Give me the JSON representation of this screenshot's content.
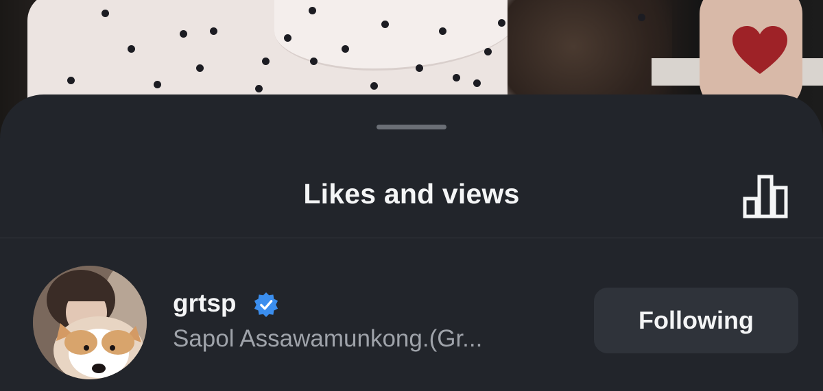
{
  "background": {
    "heart_icon": "heart-icon",
    "heart_color": "#9e2227"
  },
  "sheet": {
    "title": "Likes and views",
    "insights_icon": "bar-chart-icon",
    "background_color": "#22252b"
  },
  "likers": [
    {
      "username": "grtsp",
      "verified": true,
      "verified_color": "#3b8eee",
      "full_name": "Sapol Assawamunkong.(Gr...",
      "follow_label": "Following"
    }
  ]
}
